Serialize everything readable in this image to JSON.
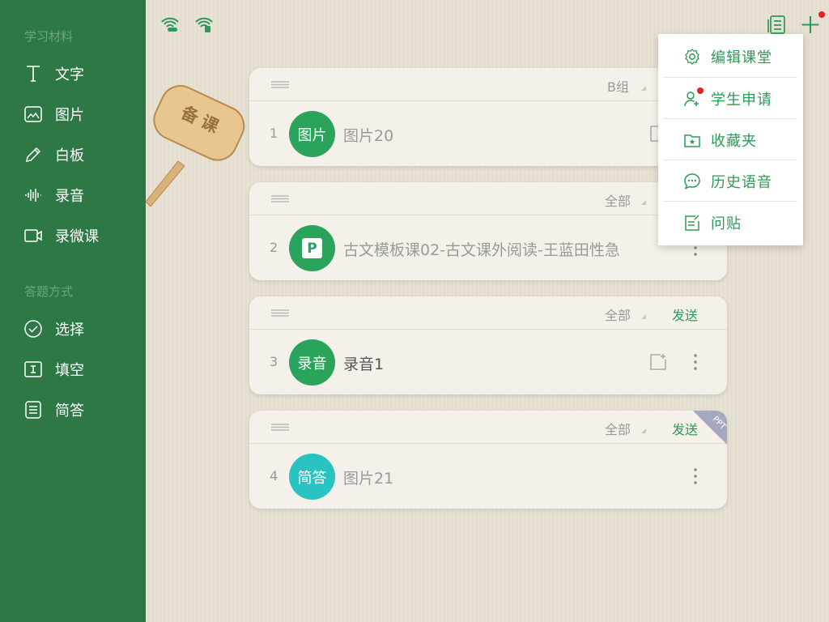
{
  "colors": {
    "sidebar": "#2e7845",
    "accent_green": "#2e9a57",
    "teal": "#29c4c1",
    "alert_red": "#e8201f",
    "ppt_tag": "#a6a8bf"
  },
  "sidebar": {
    "section_materials": "学习材料",
    "materials": [
      {
        "label": "文字",
        "icon": "text-icon"
      },
      {
        "label": "图片",
        "icon": "image-icon"
      },
      {
        "label": "白板",
        "icon": "pen-icon"
      },
      {
        "label": "录音",
        "icon": "waveform-icon"
      },
      {
        "label": "录微课",
        "icon": "video-camera-icon"
      }
    ],
    "section_answers": "答题方式",
    "answers": [
      {
        "label": "选择",
        "icon": "check-circle-icon"
      },
      {
        "label": "填空",
        "icon": "fill-blank-icon"
      },
      {
        "label": "简答",
        "icon": "document-icon"
      }
    ]
  },
  "sign": {
    "text": "备课"
  },
  "cards": [
    {
      "index": "1",
      "group": "B组",
      "send": "",
      "badge": "图片",
      "badge_color": "#2aa35b",
      "title": "图片20",
      "title_dark": false,
      "ppt": false
    },
    {
      "index": "2",
      "group": "全部",
      "send": "",
      "badge": "P",
      "badge_color": "#2aa35b",
      "title": "古文模板课02-古文课外阅读-王蓝田性急",
      "title_dark": false,
      "ppt": false
    },
    {
      "index": "3",
      "group": "全部",
      "send": "发送",
      "badge": "录音",
      "badge_color": "#2aa35b",
      "title": "录音1",
      "title_dark": true,
      "ppt": false
    },
    {
      "index": "4",
      "group": "全部",
      "send": "发送",
      "badge": "简答",
      "badge_color": "#29c4c1",
      "title": "图片21",
      "title_dark": false,
      "ppt": true,
      "ppt_label": "PPT"
    }
  ],
  "popup": {
    "items": [
      {
        "label": "编辑课堂",
        "icon": "gear-icon"
      },
      {
        "label": "学生申请",
        "icon": "add-user-icon"
      },
      {
        "label": "收藏夹",
        "icon": "folder-icon"
      },
      {
        "label": "历史语音",
        "icon": "chat-bubble-icon"
      },
      {
        "label": "问贴",
        "icon": "edit-note-icon"
      }
    ]
  }
}
